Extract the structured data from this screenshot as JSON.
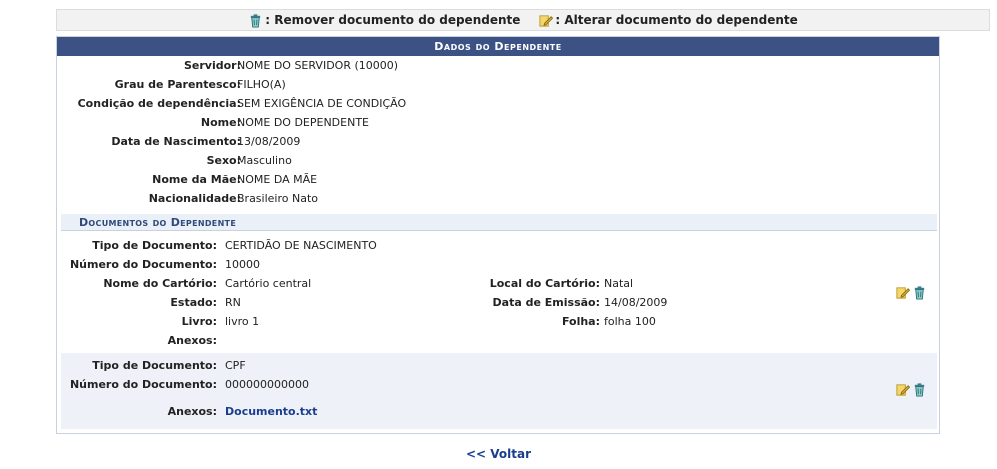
{
  "legend": {
    "remove_label": ": Remover documento do dependente",
    "edit_label": ": Alterar documento do dependente"
  },
  "panel": {
    "caption": "Dados do Dependente",
    "fields": [
      {
        "label": "Servidor:",
        "value": "NOME DO SERVIDOR (10000)"
      },
      {
        "label": "Grau de Parentesco:",
        "value": "FILHO(A)"
      },
      {
        "label": "Condição de dependência:",
        "value": "SEM EXIGÊNCIA DE CONDIÇÃO"
      },
      {
        "label": "Nome:",
        "value": "NOME DO DEPENDENTE"
      },
      {
        "label": "Data de Nascimento:",
        "value": "13/08/2009"
      },
      {
        "label": "Sexo:",
        "value": "Masculino"
      },
      {
        "label": "Nome da Mãe:",
        "value": "NOME DA MÃE"
      },
      {
        "label": "Nacionalidade:",
        "value": "Brasileiro Nato"
      }
    ]
  },
  "documents": {
    "subheader": "Documentos do Dependente",
    "doc1": {
      "tipo_label": "Tipo de Documento:",
      "tipo": "CERTIDÃO DE NASCIMENTO",
      "numero_label": "Número do Documento:",
      "numero": "10000",
      "cartorio_label": "Nome do Cartório:",
      "cartorio": "Cartório central",
      "local_label": "Local do Cartório:",
      "local": "Natal",
      "estado_label": "Estado:",
      "estado": "RN",
      "emissao_label": "Data de Emissão:",
      "emissao": "14/08/2009",
      "livro_label": "Livro:",
      "livro": "livro 1",
      "folha_label": "Folha:",
      "folha": "folha 100",
      "anexos_label": "Anexos:",
      "anexos": ""
    },
    "doc2": {
      "tipo_label": "Tipo de Documento:",
      "tipo": "CPF",
      "numero_label": "Número do Documento:",
      "numero": "000000000000",
      "anexos_label": "Anexos:",
      "anexos": "Documento.txt"
    }
  },
  "footer": {
    "back_label": "<< Voltar"
  },
  "colors": {
    "caption_bg": "#3c5285",
    "subheader_bg": "#eaf0f7",
    "link": "#1a3d8f"
  }
}
